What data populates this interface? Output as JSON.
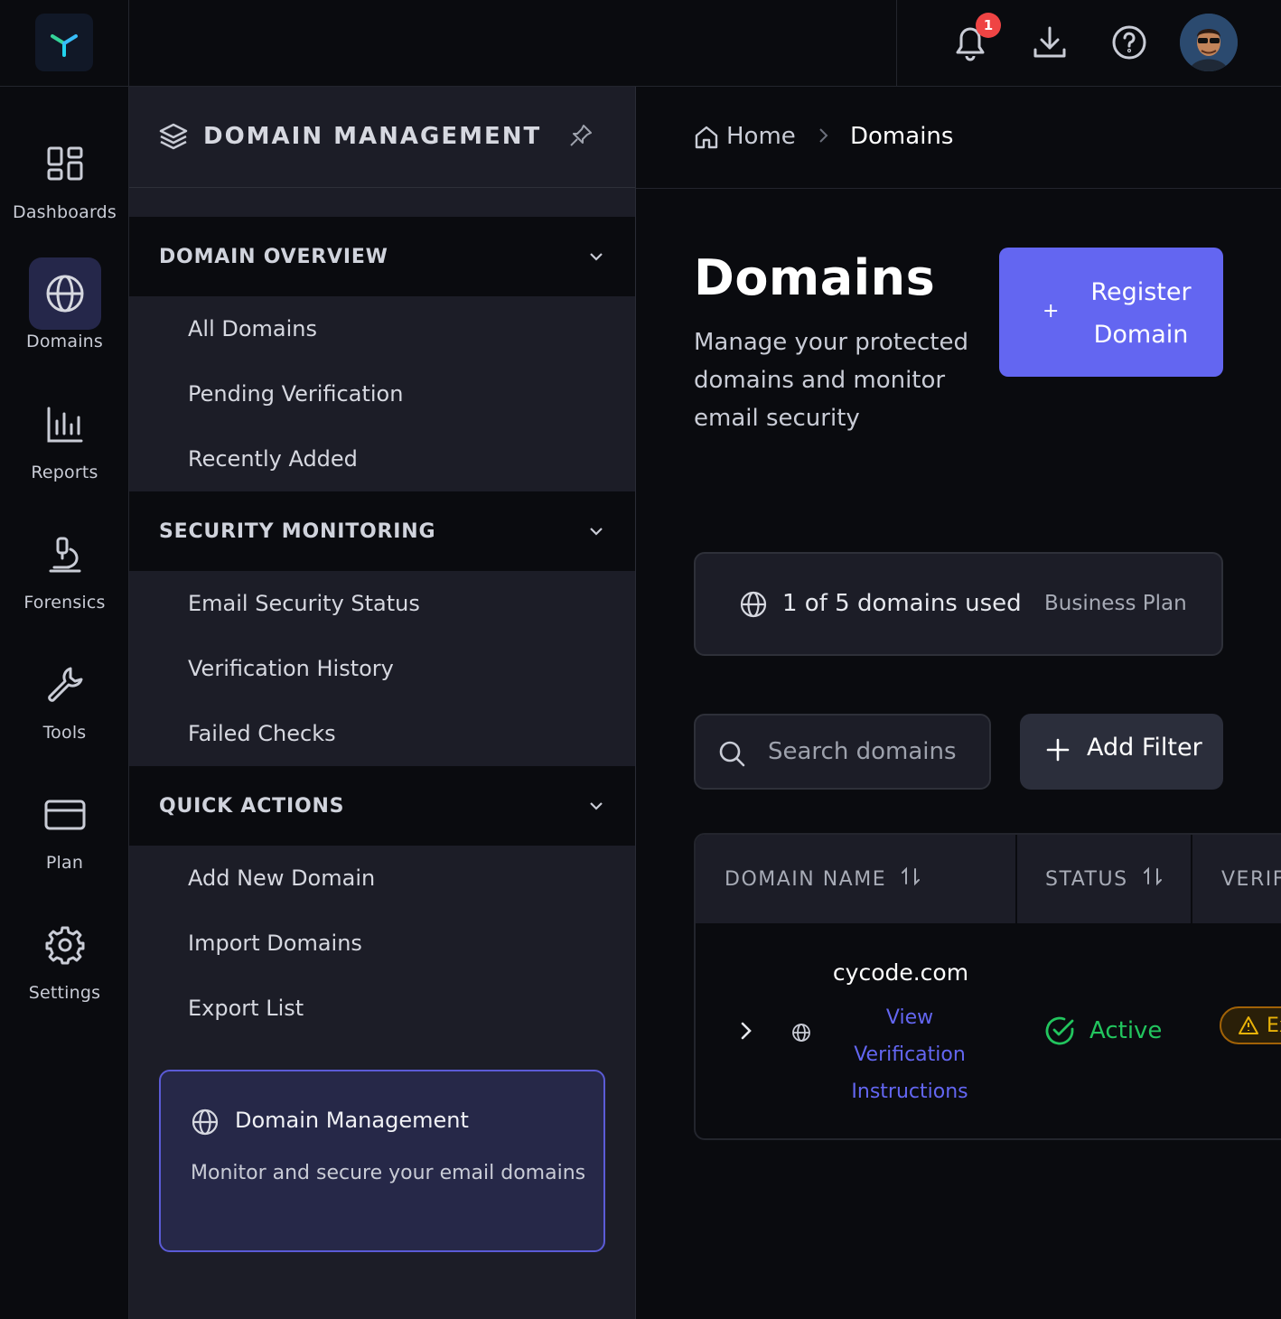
{
  "rail": {
    "items": [
      {
        "label": "Dashboards",
        "icon": "dashboard-grid-icon"
      },
      {
        "label": "Domains",
        "icon": "globe-icon",
        "active": true
      },
      {
        "label": "Reports",
        "icon": "bar-chart-icon"
      },
      {
        "label": "Forensics",
        "icon": "microscope-icon"
      },
      {
        "label": "Tools",
        "icon": "wrench-icon"
      },
      {
        "label": "Plan",
        "icon": "credit-card-icon"
      },
      {
        "label": "Settings",
        "icon": "gear-icon"
      }
    ]
  },
  "topbar": {
    "notification_count": "1"
  },
  "sidebar": {
    "title": "DOMAIN MANAGEMENT",
    "sections": [
      {
        "title": "DOMAIN OVERVIEW",
        "items": [
          "All Domains",
          "Pending Verification",
          "Recently Added"
        ]
      },
      {
        "title": "SECURITY MONITORING",
        "items": [
          "Email Security Status",
          "Verification History",
          "Failed Checks"
        ]
      },
      {
        "title": "QUICK ACTIONS",
        "items": [
          "Add New Domain",
          "Import Domains",
          "Export List"
        ]
      }
    ],
    "info_card": {
      "title": "Domain Management",
      "description": "Monitor and secure your email domains"
    }
  },
  "breadcrumb": {
    "home": "Home",
    "current": "Domains"
  },
  "main": {
    "title": "Domains",
    "description": "Manage your protected domains and monitor email security",
    "register_button": "Register Domain",
    "usage": {
      "text": "1 of 5 domains used",
      "plan": "Business Plan"
    },
    "search_placeholder": "Search domains",
    "filter_button": "Add Filter",
    "table": {
      "columns": [
        "DOMAIN NAME",
        "STATUS",
        "VERIF"
      ],
      "rows": [
        {
          "domain": "cycode.com",
          "link": "View Verification Instructions",
          "status": "Active",
          "verification": "Ex"
        }
      ]
    }
  },
  "colors": {
    "accent": "#6366f1",
    "active_status": "#22c55e",
    "warning": "#eab308",
    "badge": "#ef4444"
  }
}
